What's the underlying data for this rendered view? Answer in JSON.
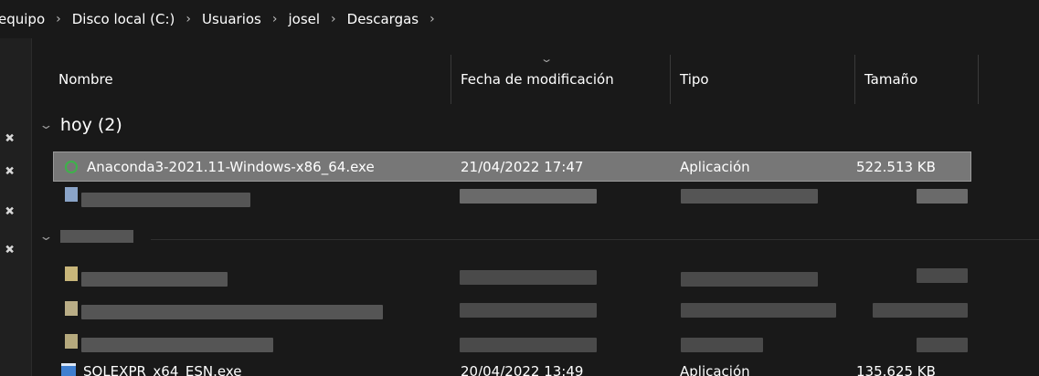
{
  "breadcrumb": {
    "items": [
      "equipo",
      "Disco local (C:)",
      "Usuarios",
      "josel",
      "Descargas"
    ],
    "separator": "›"
  },
  "columns": [
    "Nombre",
    "Fecha de modificación",
    "Tipo",
    "Tamaño"
  ],
  "groups": [
    {
      "label": "hoy (2)",
      "rows": [
        {
          "name": "Anaconda3-2021.11-Windows-x86_64.exe",
          "date": "21/04/2022 17:47",
          "type": "Aplicación",
          "size": "522.513 KB",
          "selected": true,
          "icon": "anaconda-ring-icon"
        },
        {
          "name": "",
          "date": "",
          "type": "",
          "size": "",
          "blurred": true
        }
      ]
    },
    {
      "label": "",
      "blurred": true,
      "rows": [
        {
          "blurred": true
        },
        {
          "blurred": true
        },
        {
          "blurred": true
        },
        {
          "name": "SQLEXPR_x64_ESN.exe",
          "date": "20/04/2022 13:49",
          "type": "Aplicación",
          "size": "135.625 KB",
          "icon": "installer-icon"
        }
      ]
    }
  ],
  "colors": {
    "background": "#191919",
    "selected": "#777777",
    "accent_ring": "#3db34a"
  }
}
